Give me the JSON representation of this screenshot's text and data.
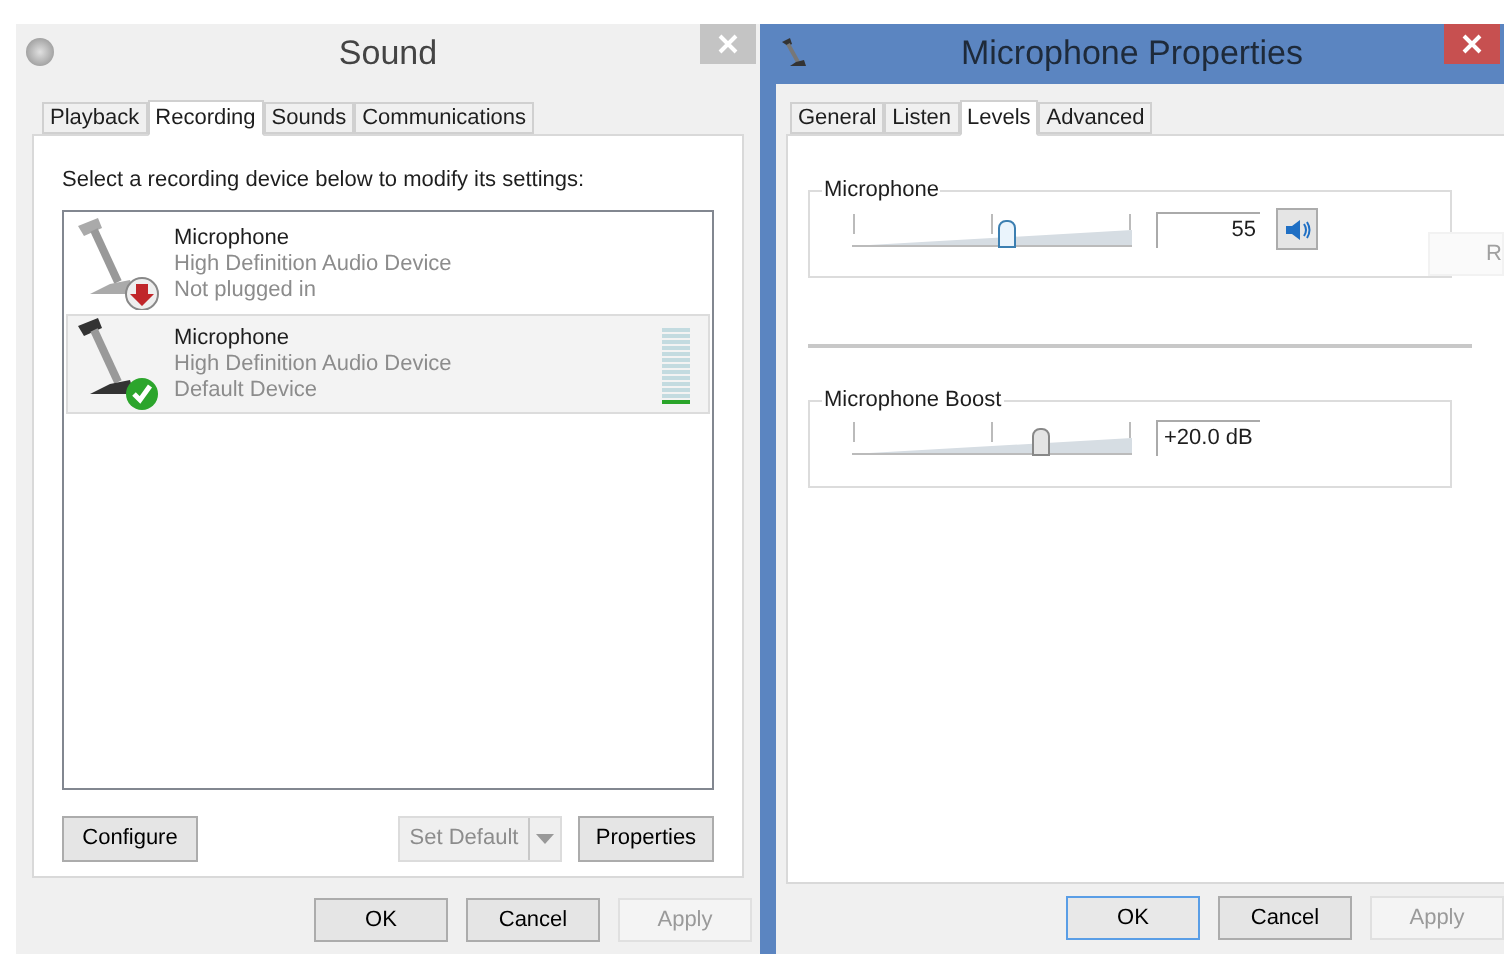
{
  "sound_window": {
    "title": "Sound",
    "active": false,
    "tabs": [
      {
        "label": "Playback",
        "selected": false
      },
      {
        "label": "Recording",
        "selected": true
      },
      {
        "label": "Sounds",
        "selected": false
      },
      {
        "label": "Communications",
        "selected": false
      }
    ],
    "instruction": "Select a recording device below to modify its settings:",
    "devices": [
      {
        "name": "Microphone",
        "description": "High Definition Audio Device",
        "status": "Not plugged in",
        "kind": "unplugged",
        "selected": false
      },
      {
        "name": "Microphone",
        "description": "High Definition Audio Device",
        "status": "Default Device",
        "kind": "default",
        "selected": true,
        "level": 0.08
      }
    ],
    "buttons": [
      {
        "label": "Configure",
        "disabled": false,
        "kind": "plain"
      },
      {
        "label": "Set Default",
        "disabled": true,
        "kind": "split"
      },
      {
        "label": "Properties",
        "disabled": false,
        "kind": "plain"
      }
    ],
    "footer_buttons": [
      {
        "label": "OK",
        "disabled": false,
        "focused": false
      },
      {
        "label": "Cancel",
        "disabled": false,
        "focused": false
      },
      {
        "label": "Apply",
        "disabled": true,
        "focused": false
      }
    ]
  },
  "properties_window": {
    "title": "Microphone Properties",
    "active": true,
    "tabs": [
      {
        "label": "General",
        "selected": false
      },
      {
        "label": "Listen",
        "selected": false
      },
      {
        "label": "Levels",
        "selected": true
      },
      {
        "label": "Advanced",
        "selected": false
      }
    ],
    "groups": [
      {
        "label": "Microphone",
        "level": 0.55,
        "value": "55",
        "mute_button": true
      },
      {
        "label": "Microphone Boost",
        "level": 0.67,
        "value": "+20.0 dB",
        "mute_button": false
      }
    ],
    "ghost_button": {
      "label": "R"
    },
    "footer_buttons": [
      {
        "label": "OK",
        "disabled": false,
        "focused": true
      },
      {
        "label": "Cancel",
        "disabled": false,
        "focused": false
      },
      {
        "label": "Apply",
        "disabled": true,
        "focused": false
      }
    ]
  }
}
